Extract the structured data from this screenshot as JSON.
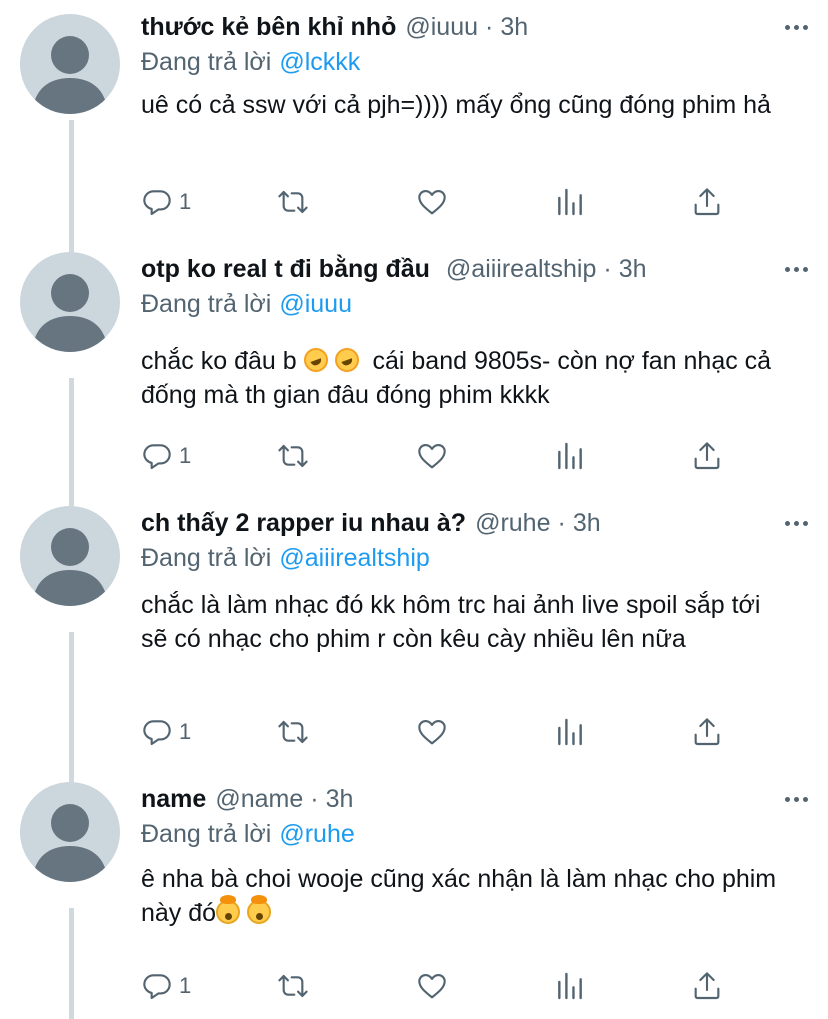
{
  "replying_to_label": "Đang trả lời",
  "tweets": [
    {
      "display_name": "thước kẻ bên khỉ nhỏ",
      "handle": "@iuuu",
      "separator": "·",
      "time": "3h",
      "reply_to": "@lckkk",
      "text_parts": [
        "uê có cả ssw với cả pjh=)))) mấy ổng cũng đóng phim hả"
      ],
      "reply_count": "1"
    },
    {
      "display_name": "otp ko real t đi bằng đầu",
      "handle": "@aiiirealtship",
      "separator": "·",
      "time": "3h",
      "reply_to": "@iuuu",
      "text_parts": [
        "chắc ko đâu b ",
        " cái band 9805s- còn nợ fan nhạc cả đống mà th gian đâu đóng phim kkkk"
      ],
      "emojis": [
        "rolling-on-floor-laughing",
        "rolling-on-floor-laughing"
      ],
      "reply_count": "1"
    },
    {
      "display_name": "ch thấy 2 rapper iu nhau à?",
      "handle": "@ruhe",
      "separator": "·",
      "time": "3h",
      "reply_to": "@aiiirealtship",
      "text_parts": [
        "chắc là làm nhạc đó kk hôm trc hai ảnh live spoil sắp tới sẽ có nhạc cho phim r còn kêu cày nhiều lên nữa"
      ],
      "reply_count": "1"
    },
    {
      "display_name": "name",
      "handle": "@name",
      "separator": "·",
      "time": "3h",
      "reply_to": "@ruhe",
      "text_parts": [
        "ê nha bà choi wooje cũng xác nhận là làm nhạc cho phim này đó"
      ],
      "emojis": [
        "exploding-head",
        "exploding-head"
      ],
      "reply_count": "1"
    }
  ],
  "icons": {
    "reply": "reply-icon",
    "retweet": "retweet-icon",
    "like": "heart-icon",
    "views": "analytics-icon",
    "share": "share-icon",
    "more": "more-icon"
  },
  "colors": {
    "mention": "#1d9bf0",
    "secondary": "#536471",
    "thread_line": "#cfd9de",
    "avatar_bg": "#ccd6dd",
    "avatar_fg": "#66757f"
  }
}
